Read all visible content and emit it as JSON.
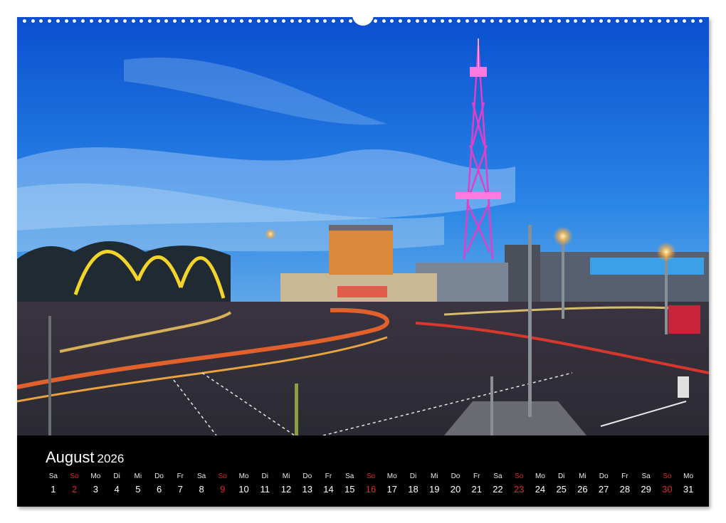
{
  "calendar": {
    "month": "August",
    "year": "2026",
    "days": [
      {
        "dow": "Sa",
        "num": "1",
        "sunday": false
      },
      {
        "dow": "So",
        "num": "2",
        "sunday": true
      },
      {
        "dow": "Mo",
        "num": "3",
        "sunday": false
      },
      {
        "dow": "Di",
        "num": "4",
        "sunday": false
      },
      {
        "dow": "Mi",
        "num": "5",
        "sunday": false
      },
      {
        "dow": "Do",
        "num": "6",
        "sunday": false
      },
      {
        "dow": "Fr",
        "num": "7",
        "sunday": false
      },
      {
        "dow": "Sa",
        "num": "8",
        "sunday": false
      },
      {
        "dow": "So",
        "num": "9",
        "sunday": true
      },
      {
        "dow": "Mo",
        "num": "10",
        "sunday": false
      },
      {
        "dow": "Di",
        "num": "11",
        "sunday": false
      },
      {
        "dow": "Mi",
        "num": "12",
        "sunday": false
      },
      {
        "dow": "Do",
        "num": "13",
        "sunday": false
      },
      {
        "dow": "Fr",
        "num": "14",
        "sunday": false
      },
      {
        "dow": "Sa",
        "num": "15",
        "sunday": false
      },
      {
        "dow": "So",
        "num": "16",
        "sunday": true
      },
      {
        "dow": "Mo",
        "num": "17",
        "sunday": false
      },
      {
        "dow": "Di",
        "num": "18",
        "sunday": false
      },
      {
        "dow": "Mi",
        "num": "19",
        "sunday": false
      },
      {
        "dow": "Do",
        "num": "20",
        "sunday": false
      },
      {
        "dow": "Fr",
        "num": "21",
        "sunday": false
      },
      {
        "dow": "Sa",
        "num": "22",
        "sunday": false
      },
      {
        "dow": "So",
        "num": "23",
        "sunday": true
      },
      {
        "dow": "Mo",
        "num": "24",
        "sunday": false
      },
      {
        "dow": "Di",
        "num": "25",
        "sunday": false
      },
      {
        "dow": "Mi",
        "num": "26",
        "sunday": false
      },
      {
        "dow": "Do",
        "num": "27",
        "sunday": false
      },
      {
        "dow": "Fr",
        "num": "28",
        "sunday": false
      },
      {
        "dow": "Sa",
        "num": "29",
        "sunday": false
      },
      {
        "dow": "So",
        "num": "30",
        "sunday": true
      },
      {
        "dow": "Mo",
        "num": "31",
        "sunday": false
      }
    ]
  },
  "colors": {
    "sunday": "#e0262b",
    "sky_top": "#0b4fd0",
    "tower": "#e040c8"
  }
}
